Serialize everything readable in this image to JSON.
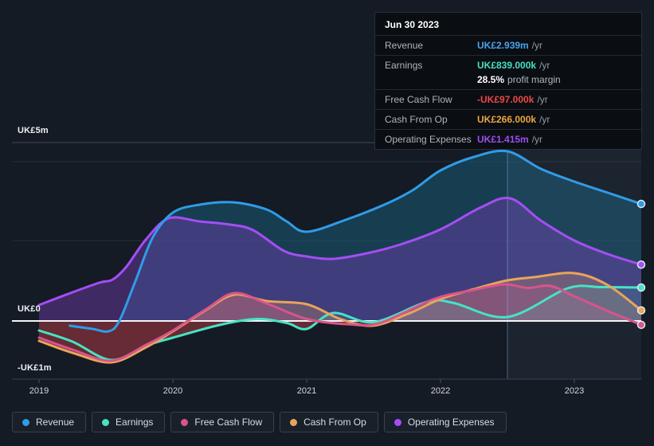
{
  "tooltip": {
    "title": "Jun 30 2023",
    "rows": [
      {
        "label": "Revenue",
        "value": "UK£2.939m",
        "suffix": "/yr",
        "color": "#4aa3f0"
      },
      {
        "label": "Earnings",
        "value": "UK£839.000k",
        "suffix": "/yr",
        "color": "#45e0c2"
      },
      {
        "label": "Free Cash Flow",
        "value": "-UK£97.000k",
        "suffix": "/yr",
        "color": "#ea4848"
      },
      {
        "label": "Cash From Op",
        "value": "UK£266.000k",
        "suffix": "/yr",
        "color": "#eaa83e"
      },
      {
        "label": "Operating Expenses",
        "value": "UK£1.415m",
        "suffix": "/yr",
        "color": "#9b4ff2"
      }
    ],
    "profit_margin": {
      "value": "28.5%",
      "label": "profit margin"
    }
  },
  "legend": {
    "items": [
      {
        "label": "Revenue",
        "color": "#2f9ce8"
      },
      {
        "label": "Earnings",
        "color": "#46e3c3"
      },
      {
        "label": "Free Cash Flow",
        "color": "#d8548b"
      },
      {
        "label": "Cash From Op",
        "color": "#e9a45b"
      },
      {
        "label": "Operating Expenses",
        "color": "#a44ef4"
      }
    ]
  },
  "chart_data": {
    "type": "area",
    "unit": "UK£ millions per year (TTM)",
    "x_ticks": [
      "2019",
      "2020",
      "2021",
      "2022",
      "2023"
    ],
    "x_range": [
      2019.0,
      2023.5
    ],
    "ylim": [
      -1.46,
      4.48
    ],
    "grid": true,
    "legend_position": "bottom",
    "highlight_from_x": 2022.5,
    "selected_point_x": 2023.5,
    "y_gridline_labels": [
      {
        "text": "UK£5m",
        "value": 5
      },
      {
        "text": "UK£0",
        "value": 0
      },
      {
        "text": "-UK£1m",
        "value": -1
      }
    ],
    "series": [
      {
        "name": "Revenue",
        "color": "#2f9ce8",
        "fill": "rgba(25,95,125,0.50)",
        "end_value_label": "UK£2.939m",
        "points": [
          [
            2019.23,
            -0.12
          ],
          [
            2019.4,
            -0.2
          ],
          [
            2019.52,
            -0.26
          ],
          [
            2019.6,
            0.0
          ],
          [
            2019.72,
            1.0
          ],
          [
            2019.85,
            2.1
          ],
          [
            2020.0,
            2.72
          ],
          [
            2020.2,
            2.92
          ],
          [
            2020.45,
            2.98
          ],
          [
            2020.7,
            2.8
          ],
          [
            2020.85,
            2.5
          ],
          [
            2021.0,
            2.24
          ],
          [
            2021.3,
            2.55
          ],
          [
            2021.6,
            2.95
          ],
          [
            2021.8,
            3.3
          ],
          [
            2022.0,
            3.78
          ],
          [
            2022.25,
            4.12
          ],
          [
            2022.5,
            4.26
          ],
          [
            2022.75,
            3.82
          ],
          [
            2023.0,
            3.5
          ],
          [
            2023.25,
            3.22
          ],
          [
            2023.5,
            2.939
          ]
        ]
      },
      {
        "name": "Earnings",
        "color": "#46e3c3",
        "fill": "rgba(70,227,195,0.13)",
        "end_value_label": "UK£839.000k",
        "points": [
          [
            2019.0,
            -0.24
          ],
          [
            2019.25,
            -0.52
          ],
          [
            2019.54,
            -0.98
          ],
          [
            2019.8,
            -0.62
          ],
          [
            2020.0,
            -0.42
          ],
          [
            2020.35,
            -0.1
          ],
          [
            2020.63,
            0.05
          ],
          [
            2020.85,
            -0.05
          ],
          [
            2021.0,
            -0.2
          ],
          [
            2021.2,
            0.2
          ],
          [
            2021.5,
            -0.03
          ],
          [
            2021.9,
            0.48
          ],
          [
            2022.1,
            0.45
          ],
          [
            2022.5,
            0.1
          ],
          [
            2022.95,
            0.82
          ],
          [
            2023.2,
            0.85
          ],
          [
            2023.5,
            0.839
          ]
        ]
      },
      {
        "name": "Free Cash Flow",
        "color": "#d8548b",
        "fill": "rgba(216,84,139,0.22)",
        "end_value_label": "-UK£97.000k",
        "points": [
          [
            2019.0,
            -0.42
          ],
          [
            2019.25,
            -0.72
          ],
          [
            2019.54,
            -1.0
          ],
          [
            2019.8,
            -0.6
          ],
          [
            2020.0,
            -0.24
          ],
          [
            2020.25,
            0.3
          ],
          [
            2020.46,
            0.7
          ],
          [
            2020.7,
            0.44
          ],
          [
            2021.0,
            0.05
          ],
          [
            2021.3,
            -0.08
          ],
          [
            2021.55,
            -0.05
          ],
          [
            2021.95,
            0.55
          ],
          [
            2022.25,
            0.78
          ],
          [
            2022.48,
            0.92
          ],
          [
            2022.65,
            0.83
          ],
          [
            2022.82,
            0.88
          ],
          [
            2023.0,
            0.62
          ],
          [
            2023.25,
            0.25
          ],
          [
            2023.5,
            -0.097
          ]
        ]
      },
      {
        "name": "Cash From Op",
        "color": "#e9a45b",
        "fill": "rgba(233,164,91,0.26)",
        "end_value_label": "UK£266.000k",
        "points": [
          [
            2019.0,
            -0.5
          ],
          [
            2019.25,
            -0.8
          ],
          [
            2019.54,
            -1.04
          ],
          [
            2019.8,
            -0.66
          ],
          [
            2020.0,
            -0.26
          ],
          [
            2020.25,
            0.28
          ],
          [
            2020.46,
            0.66
          ],
          [
            2020.7,
            0.5
          ],
          [
            2021.0,
            0.42
          ],
          [
            2021.25,
            0.05
          ],
          [
            2021.49,
            -0.12
          ],
          [
            2021.75,
            0.17
          ],
          [
            2022.0,
            0.55
          ],
          [
            2022.25,
            0.8
          ],
          [
            2022.5,
            1.02
          ],
          [
            2022.7,
            1.1
          ],
          [
            2023.0,
            1.2
          ],
          [
            2023.25,
            0.9
          ],
          [
            2023.5,
            0.266
          ]
        ]
      },
      {
        "name": "Operating Expenses",
        "color": "#a44ef4",
        "fill": "rgba(115,62,180,0.45)",
        "end_value_label": "UK£1.415m",
        "points": [
          [
            2019.0,
            0.4
          ],
          [
            2019.25,
            0.72
          ],
          [
            2019.45,
            0.96
          ],
          [
            2019.55,
            1.04
          ],
          [
            2019.65,
            1.35
          ],
          [
            2019.8,
            2.05
          ],
          [
            2019.97,
            2.58
          ],
          [
            2020.2,
            2.5
          ],
          [
            2020.43,
            2.42
          ],
          [
            2020.6,
            2.28
          ],
          [
            2020.83,
            1.76
          ],
          [
            2021.0,
            1.62
          ],
          [
            2021.2,
            1.56
          ],
          [
            2021.45,
            1.7
          ],
          [
            2021.7,
            1.92
          ],
          [
            2022.0,
            2.3
          ],
          [
            2022.3,
            2.85
          ],
          [
            2022.52,
            3.08
          ],
          [
            2022.75,
            2.52
          ],
          [
            2023.0,
            2.02
          ],
          [
            2023.25,
            1.68
          ],
          [
            2023.5,
            1.415
          ]
        ]
      }
    ]
  }
}
